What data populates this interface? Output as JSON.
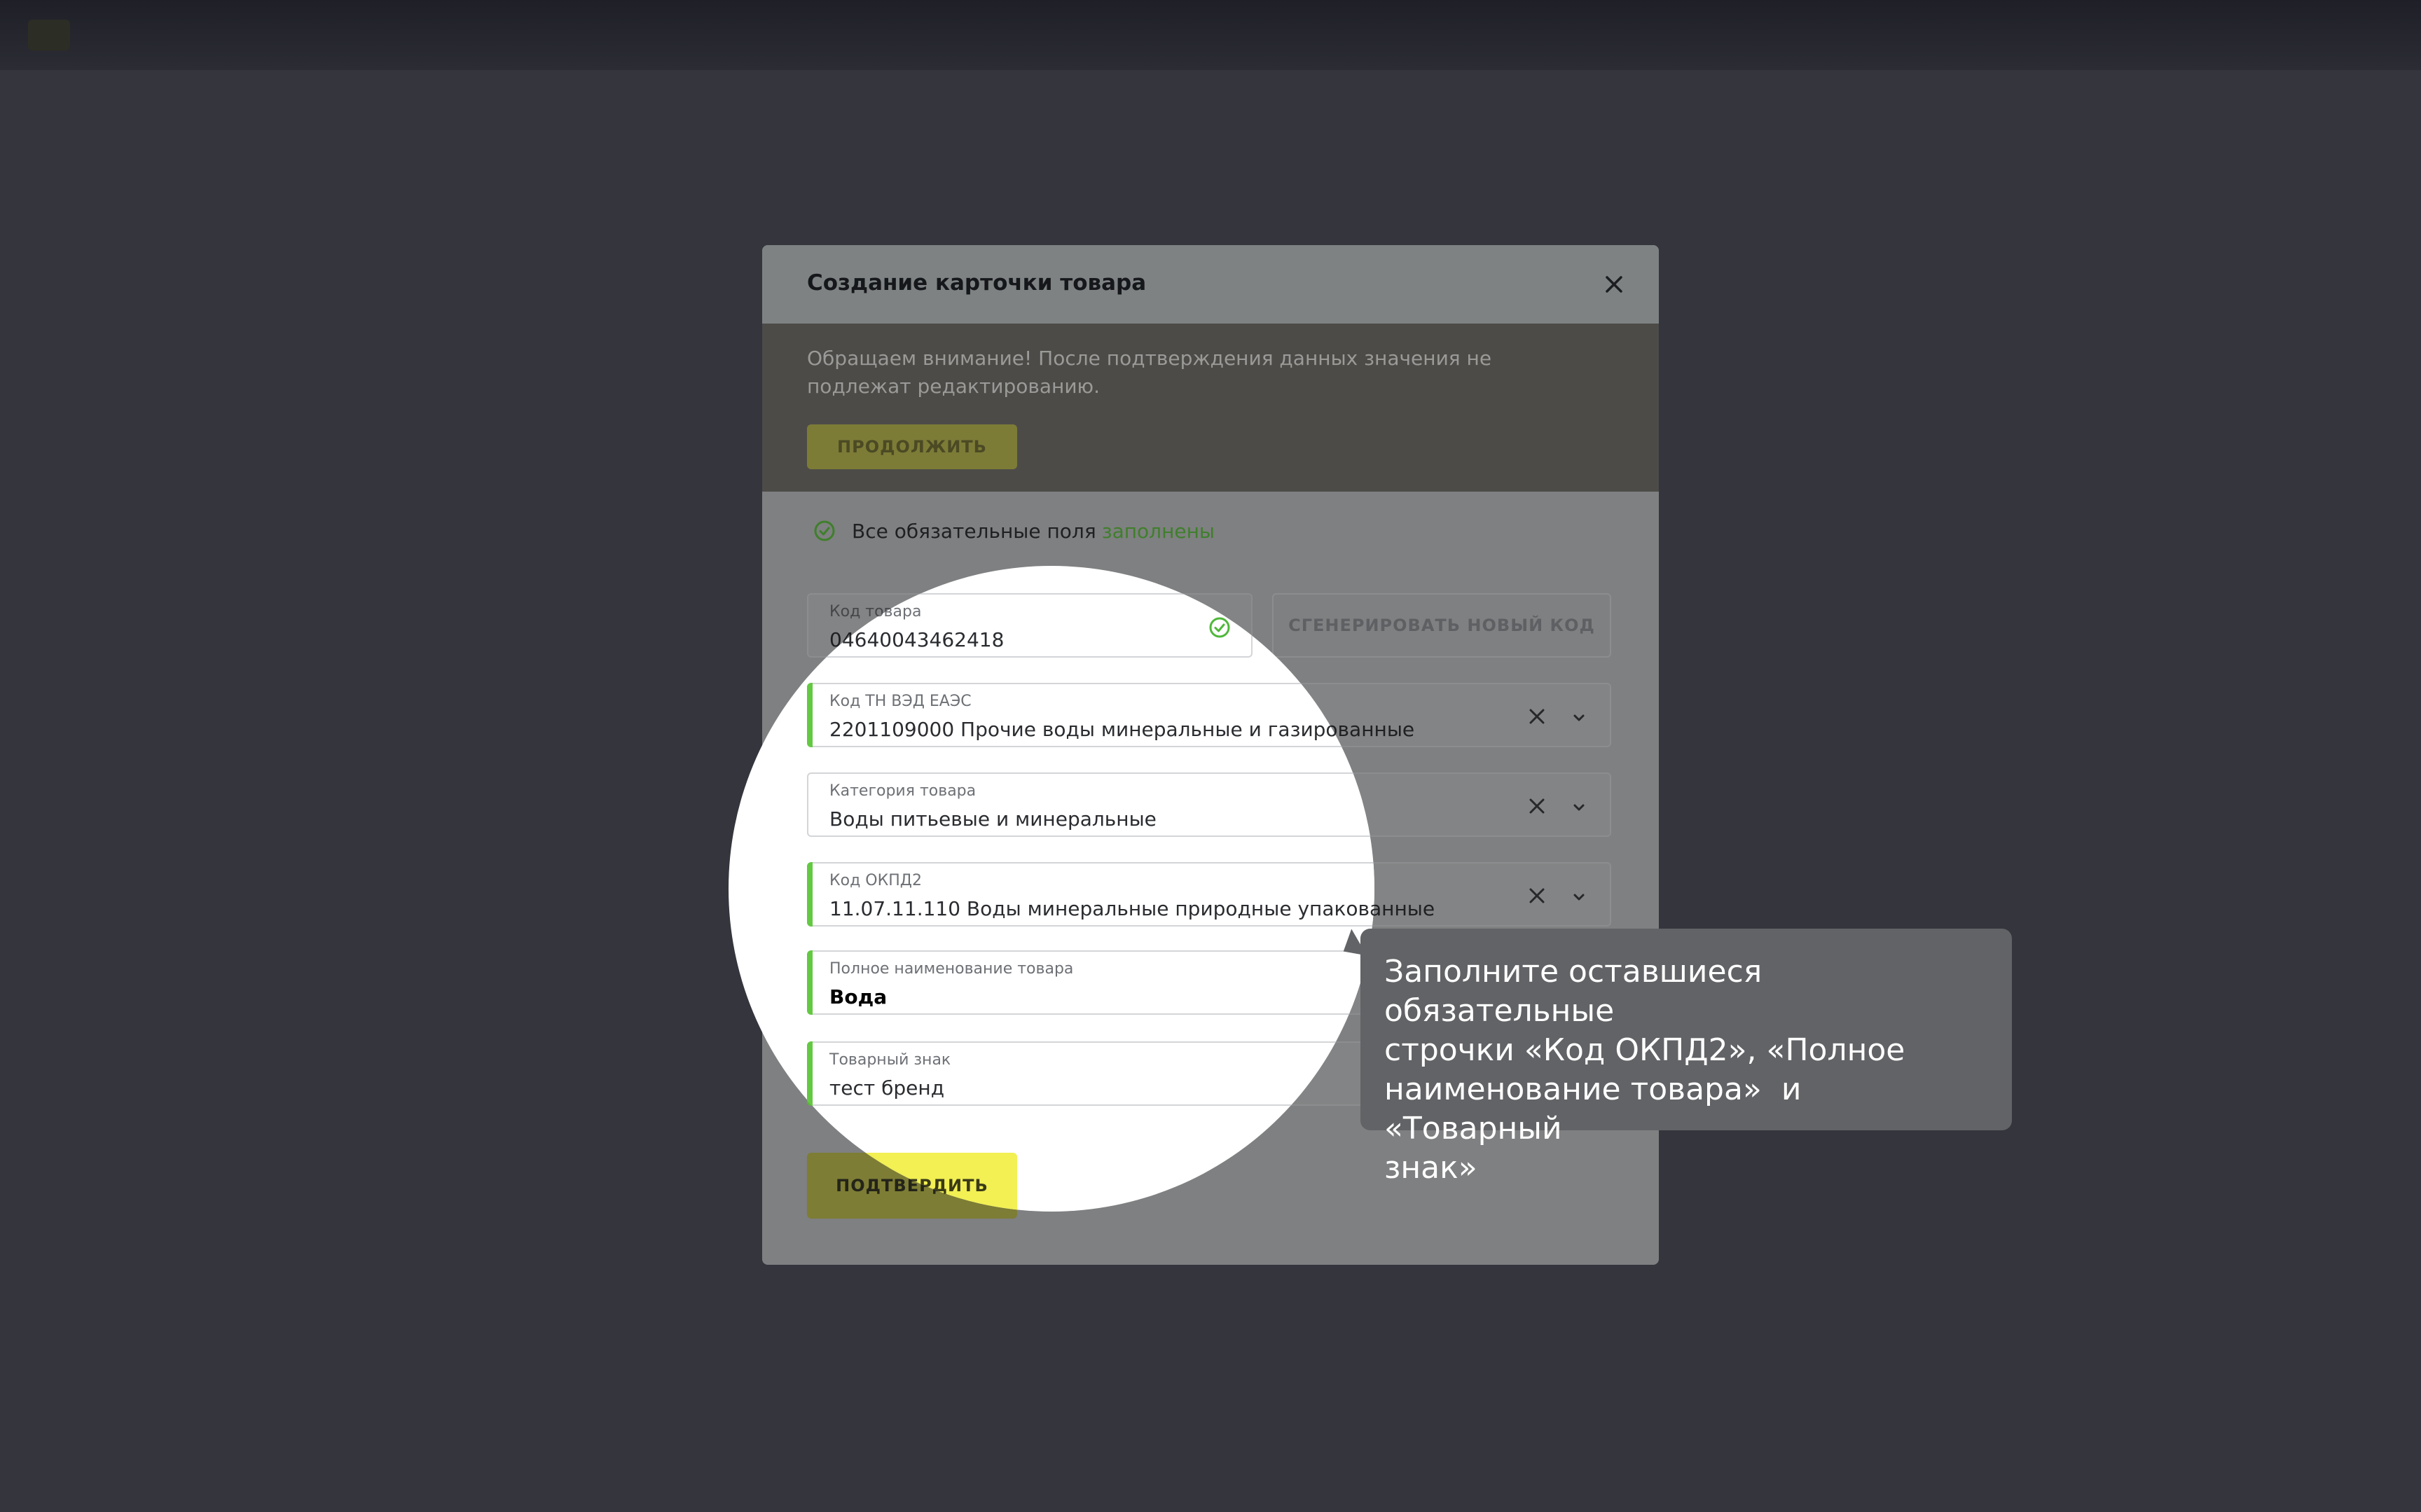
{
  "modal": {
    "title": "Создание карточки товара",
    "notice_text": "Обращаем внимание! После подтверждения данных значения не подлежат редактированию.",
    "continue_label": "ПРОДОЛЖИТЬ",
    "status_prefix": "Все обязательные поля",
    "status_highlight": "заполнены",
    "fields": {
      "product_code": {
        "label": "Код товара",
        "value": "04640043462418"
      },
      "tnved": {
        "label": "Код ТН ВЭД ЕАЭС",
        "value": "2201109000 Прочие воды минеральные и газированные"
      },
      "category": {
        "label": "Категория товара",
        "value": "Воды питьевые и минеральные"
      },
      "okpd2": {
        "label": "Код ОКПД2",
        "value": "11.07.11.110 Воды минеральные природные упакованные"
      },
      "full_name": {
        "label": "Полное наименование товара",
        "value": "Вода"
      },
      "trademark": {
        "label": "Товарный знак",
        "value": "тест бренд"
      }
    },
    "generate_label": "СГЕНЕРИРОВАТЬ НОВЫЙ КОД",
    "confirm_label": "ПОДТВЕРДИТЬ"
  },
  "tooltip": {
    "text": "Заполните оставшиеся обязательные\nстрочки «Код ОКПД2», «Полное\nнаименование товара»  и «Товарный\nзнак»"
  },
  "colors": {
    "accent_green": "#5ab936",
    "confirm_yellow": "#f2f053",
    "overlay_bg": "#34353d"
  },
  "icons": [
    "close-icon",
    "check-circle-icon",
    "clear-icon",
    "chevron-down-icon"
  ]
}
